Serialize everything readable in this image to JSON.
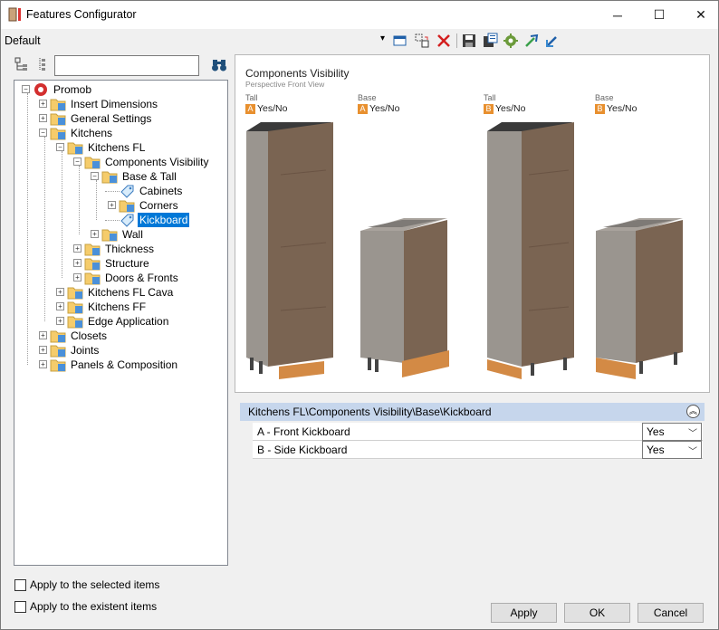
{
  "window": {
    "title": "Features Configurator",
    "controls": {
      "minimize": "─",
      "maximize": "☐",
      "close": "✕"
    }
  },
  "toolbar": {
    "preset": "Default",
    "preset_arrow": "▾"
  },
  "search": {
    "value": "",
    "placeholder": ""
  },
  "tree": {
    "root": "Promob",
    "insert_dimensions": "Insert Dimensions",
    "general_settings": "General Settings",
    "kitchens": "Kitchens",
    "kitchens_fl": "Kitchens FL",
    "components_visibility": "Components Visibility",
    "base_tall": "Base & Tall",
    "cabinets": "Cabinets",
    "corners": "Corners",
    "kickboard": "Kickboard",
    "wall": "Wall",
    "thickness": "Thickness",
    "structure": "Structure",
    "doors_fronts": "Doors & Fronts",
    "kitchens_fl_cava": "Kitchens FL Cava",
    "kitchens_ff": "Kitchens FF",
    "edge_application": "Edge Application",
    "closets": "Closets",
    "joints": "Joints",
    "panels_composition": "Panels & Composition"
  },
  "preview": {
    "title": "Components Visibility",
    "subtitle": "Perspective Front View",
    "cabinets": [
      {
        "label": "Tall",
        "badge": "A",
        "option": "Yes/No"
      },
      {
        "label": "Base",
        "badge": "A",
        "option": "Yes/No"
      },
      {
        "label": "Tall",
        "badge": "B",
        "option": "Yes/No"
      },
      {
        "label": "Base",
        "badge": "B",
        "option": "Yes/No"
      }
    ]
  },
  "properties": {
    "group_title": "Kitchens FL\\Components Visibility\\Base\\Kickboard",
    "rows": [
      {
        "label": "A -  Front Kickboard",
        "value": "Yes"
      },
      {
        "label": "B -  Side Kickboard",
        "value": "Yes"
      }
    ]
  },
  "options": {
    "apply_selected": "Apply to the selected items",
    "apply_existent": "Apply to the existent items"
  },
  "buttons": {
    "apply": "Apply",
    "ok": "OK",
    "cancel": "Cancel"
  },
  "colors": {
    "accent": "#0078d7",
    "badge": "#e8902f",
    "group_header": "#c6d6ec",
    "wood": "#7a6452",
    "kickboard": "#d38a45"
  }
}
